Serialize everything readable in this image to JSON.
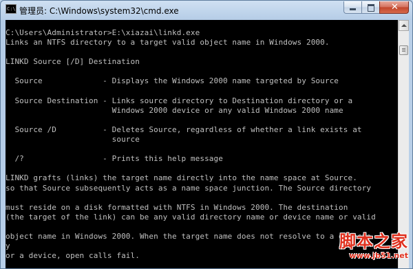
{
  "window": {
    "title": "管理员: C:\\Windows\\system32\\cmd.exe",
    "icon": "cmd-icon",
    "controls": {
      "minimize": "minimize-icon",
      "maximize": "maximize-icon",
      "close": "close-icon",
      "close_glyph": "✕"
    }
  },
  "console": {
    "lines": [
      "C:\\Users\\Administrator>E:\\xiazai\\linkd.exe",
      "Links an NTFS directory to a target valid object name in Windows 2000.",
      "",
      "LINKD Source [/D] Destination",
      "",
      "  Source             - Displays the Windows 2000 name targeted by Source",
      "",
      "  Source Destination - Links source directory to Destination directory or a",
      "                       Windows 2000 device or any valid Windows 2000 name",
      "",
      "  Source /D          - Deletes Source, regardless of whether a link exists at",
      "                       source",
      "",
      "  /?                 - Prints this help message",
      "",
      "LINKD grafts (links) the target name directly into the name space at Source.",
      "so that Source subsequently acts as a name space junction. The Source directory",
      "",
      "must reside on a disk formatted with NTFS in Windows 2000. The destination",
      "(the target of the link) can be any valid directory name or device name or valid",
      "",
      "object name in Windows 2000. When the target name does not resolve to a directo",
      "y",
      "or a device, open calls fail."
    ],
    "text_color": "#c0c0c0",
    "background": "#000000"
  },
  "watermark": {
    "main": "脚本之家",
    "url": "www.jb51.net",
    "color": "#e0301e"
  }
}
